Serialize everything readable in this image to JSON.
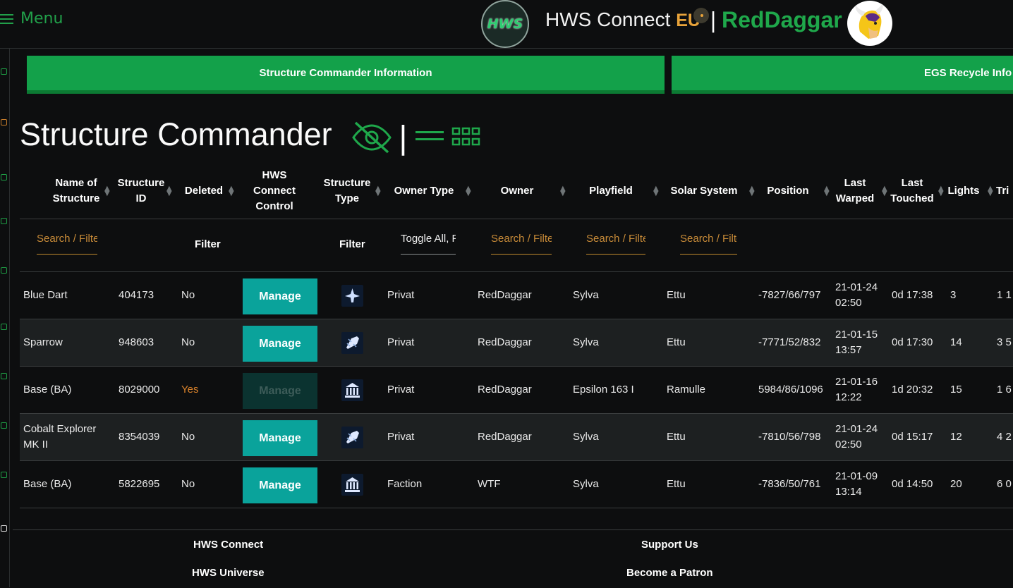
{
  "header": {
    "menu_label": "Menu",
    "logo_text": "HWS",
    "brand": "HWS Connect",
    "region": "EU",
    "separator": "|",
    "username": "RedDaggar"
  },
  "tabs": [
    {
      "label": "Structure Commander Information"
    },
    {
      "label": "EGS Recycle Info"
    }
  ],
  "page": {
    "title": "Structure Commander",
    "divider": "|"
  },
  "table": {
    "columns": [
      {
        "label": "Name of Structure"
      },
      {
        "label": "Structure ID"
      },
      {
        "label": "Deleted"
      },
      {
        "label": "HWS Connect Control"
      },
      {
        "label": "Structure Type"
      },
      {
        "label": "Owner Type"
      },
      {
        "label": "Owner"
      },
      {
        "label": "Playfield"
      },
      {
        "label": "Solar System"
      },
      {
        "label": "Position"
      },
      {
        "label": "Last Warped"
      },
      {
        "label": "Last Touched"
      },
      {
        "label": "Lights"
      },
      {
        "label": "Tri"
      }
    ],
    "filters": {
      "name_placeholder": "Search / Filte",
      "deleted_label": "Filter",
      "type_label": "Filter",
      "owner_type_value": "Toggle All, F",
      "owner_placeholder": "Search / Filte",
      "playfield_placeholder": "Search / Filte",
      "solar_placeholder": "Search / Filte"
    },
    "rows": [
      {
        "name": "Blue Dart",
        "id": "404173",
        "deleted": "No",
        "manage": "Manage",
        "type_icon": "hover-vessel-icon",
        "owner_type": "Privat",
        "owner": "RedDaggar",
        "playfield": "Sylva",
        "solar": "Ettu",
        "position": "-7827/66/797",
        "warped_date": "21-01-24",
        "warped_time": "02:50",
        "touched": "0d 17:38",
        "lights": "3",
        "tri": "1 1"
      },
      {
        "name": "Sparrow",
        "id": "948603",
        "deleted": "No",
        "manage": "Manage",
        "type_icon": "small-vessel-icon",
        "owner_type": "Privat",
        "owner": "RedDaggar",
        "playfield": "Sylva",
        "solar": "Ettu",
        "position": "-7771/52/832",
        "warped_date": "21-01-15",
        "warped_time": "13:57",
        "touched": "0d 17:30",
        "lights": "14",
        "tri": "3 5"
      },
      {
        "name": "Base (BA)",
        "id": "8029000",
        "deleted": "Yes",
        "manage": "Manage",
        "type_icon": "base-icon",
        "owner_type": "Privat",
        "owner": "RedDaggar",
        "playfield": "Epsilon 163 I",
        "solar": "Ramulle",
        "position": "5984/86/1096",
        "warped_date": "21-01-16",
        "warped_time": "12:22",
        "touched": "1d 20:32",
        "lights": "15",
        "tri": "1 6"
      },
      {
        "name": "Cobalt Explorer MK II",
        "id": "8354039",
        "deleted": "No",
        "manage": "Manage",
        "type_icon": "small-vessel-icon",
        "owner_type": "Privat",
        "owner": "RedDaggar",
        "playfield": "Sylva",
        "solar": "Ettu",
        "position": "-7810/56/798",
        "warped_date": "21-01-24",
        "warped_time": "02:50",
        "touched": "0d 15:17",
        "lights": "12",
        "tri": "4 2"
      },
      {
        "name": "Base (BA)",
        "id": "5822695",
        "deleted": "No",
        "manage": "Manage",
        "type_icon": "base-icon",
        "owner_type": "Faction",
        "owner": "WTF",
        "playfield": "Sylva",
        "solar": "Ettu",
        "position": "-7836/50/761",
        "warped_date": "21-01-09",
        "warped_time": "13:14",
        "touched": "0d 14:50",
        "lights": "20",
        "tri": "6 0"
      }
    ]
  },
  "footer": {
    "col1": [
      "HWS Connect",
      "HWS Universe"
    ],
    "col2": [
      "Support Us",
      "Become a Patron"
    ]
  },
  "colors": {
    "accent_green": "#13a14a",
    "manage_teal": "#0aa39b",
    "filter_orange": "#c88b38",
    "region_orange": "#e8a33a",
    "deleted_yes": "#d9822b"
  }
}
